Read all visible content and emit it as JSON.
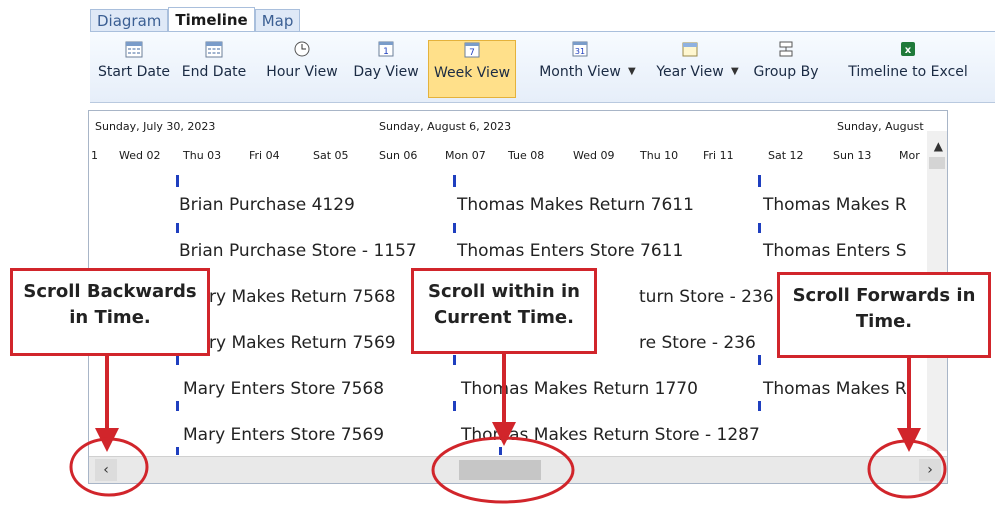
{
  "tabs": [
    "Diagram",
    "Timeline",
    "Map"
  ],
  "active_tab": "Timeline",
  "toolbar": {
    "start_date": "Start Date",
    "end_date": "End Date",
    "hour_view": "Hour View",
    "day_view": "Day View",
    "week_view": "Week View",
    "month_view": "Month View",
    "year_view": "Year View",
    "group_by": "Group By",
    "timeline_to_excel": "Timeline to Excel",
    "day_icon_num": "1",
    "week_icon_num": "7",
    "month_icon_num": "31",
    "excel_icon_letter": "x"
  },
  "timeline": {
    "dates": [
      "Sunday, July 30, 2023",
      "Sunday, August 6, 2023",
      "Sunday, August"
    ],
    "days": [
      "1",
      "Wed 02",
      "Thu 03",
      "Fri 04",
      "Sat 05",
      "Sun 06",
      "Mon 07",
      "Tue 08",
      "Wed 09",
      "Thu 10",
      "Fri 11",
      "Sat 12",
      "Sun 13",
      "Mor"
    ],
    "events": {
      "col1": [
        "Brian Purchase 4129",
        "Brian Purchase Store - 1157",
        "ry Makes Return 7568",
        "ry Makes Return 7569",
        "Mary Enters Store 7568",
        "Mary Enters Store 7569"
      ],
      "col2": [
        "Thomas Makes Return 7611",
        "Thomas Enters Store 7611",
        "turn Store - 236",
        "re Store - 236",
        "Thomas Makes Return 1770",
        "Thomas Makes Return Store - 1287"
      ],
      "col3": [
        "Thomas Makes R",
        "Thomas Enters S",
        "Thomas Makes R"
      ]
    },
    "scroll_left": "‹",
    "scroll_right": "›"
  },
  "callouts": {
    "backwards": "Scroll Backwards in Time.",
    "within": "Scroll within in Current Time.",
    "forwards": "Scroll Forwards in Time."
  },
  "colors": {
    "callout_red": "#d1252b",
    "tick_blue": "#1f3fbf",
    "active_button": "#ffe08a",
    "tab_text": "#3b5f93"
  }
}
